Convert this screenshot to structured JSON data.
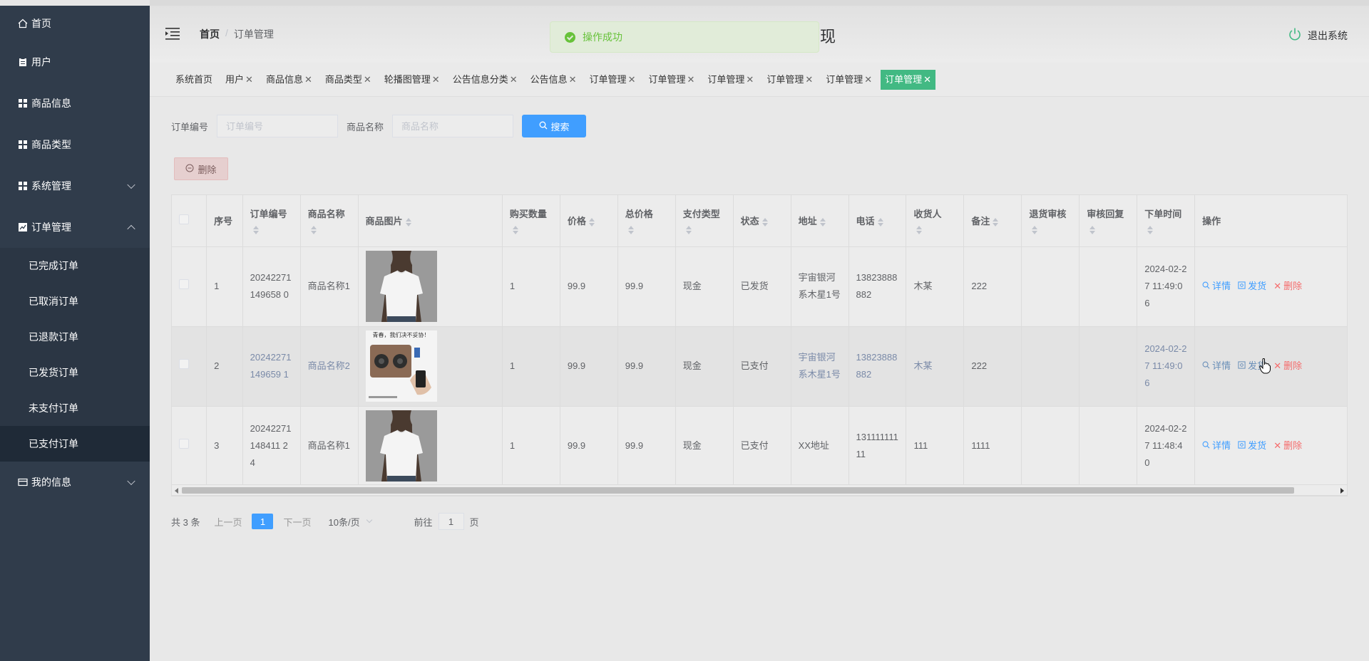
{
  "sidebar": {
    "items": [
      {
        "label": "首页",
        "icon": "home-icon"
      },
      {
        "label": "用户",
        "icon": "clipboard-icon"
      },
      {
        "label": "商品信息",
        "icon": "grid-icon"
      },
      {
        "label": "商品类型",
        "icon": "grid-icon"
      },
      {
        "label": "系统管理",
        "icon": "grid-icon"
      },
      {
        "label": "订单管理",
        "icon": "chart-icon"
      }
    ],
    "sub_items": [
      "已完成订单",
      "已取消订单",
      "已退款订单",
      "已发货订单",
      "未支付订单",
      "已支付订单"
    ],
    "last_item": {
      "label": "我的信息",
      "icon": "card-icon"
    }
  },
  "header": {
    "breadcrumb_home": "首页",
    "breadcrumb_sep": "/",
    "breadcrumb_current": "订单管理",
    "title_partial": "现",
    "logout": "退出系统"
  },
  "toast": {
    "message": "操作成功"
  },
  "tabs": [
    "系统首页",
    "用户",
    "商品信息",
    "商品类型",
    "轮播图管理",
    "公告信息分类",
    "公告信息",
    "订单管理",
    "订单管理",
    "订单管理",
    "订单管理",
    "订单管理",
    "订单管理"
  ],
  "search": {
    "order_no_label": "订单编号",
    "order_no_placeholder": "订单编号",
    "product_name_label": "商品名称",
    "product_name_placeholder": "商品名称",
    "search_button": "搜索"
  },
  "delete_button": "删除",
  "table": {
    "headers": [
      "序号",
      "订单编号",
      "商品名称",
      "商品图片",
      "购买数量",
      "价格",
      "总价格",
      "支付类型",
      "状态",
      "地址",
      "电话",
      "收货人",
      "备注",
      "退货审核",
      "审核回复",
      "下单时间",
      "操作"
    ],
    "rows": [
      {
        "idx": "1",
        "order_no": "20242271149658 0",
        "product": "商品名称1",
        "image": "tshirt",
        "qty": "1",
        "price": "99.9",
        "total": "99.9",
        "pay_type": "现金",
        "status": "已发货",
        "address": "宇宙银河系木星1号",
        "phone": "13823888882",
        "receiver": "木某",
        "remark": "222",
        "return_audit": "",
        "audit_reply": "",
        "time": "2024-02-27 11:49:06"
      },
      {
        "idx": "2",
        "order_no": "20242271149659 1",
        "product": "商品名称2",
        "image": "speaker",
        "qty": "1",
        "price": "99.9",
        "total": "99.9",
        "pay_type": "现金",
        "status": "已支付",
        "address": "宇宙银河系木星1号",
        "phone": "13823888882",
        "receiver": "木某",
        "remark": "222",
        "return_audit": "",
        "audit_reply": "",
        "time": "2024-02-27 11:49:06"
      },
      {
        "idx": "3",
        "order_no": "20242271148411 24",
        "product": "商品名称1",
        "image": "tshirt",
        "qty": "1",
        "price": "99.9",
        "total": "99.9",
        "pay_type": "现金",
        "status": "已支付",
        "address": "XX地址",
        "phone": "13111111111",
        "receiver": "111",
        "remark": "1111",
        "return_audit": "",
        "audit_reply": "",
        "time": "2024-02-27 11:48:40"
      }
    ],
    "ops": {
      "detail": "详情",
      "ship": "发货",
      "delete": "删除"
    },
    "speaker_caption": "青春，我们决不妥协！"
  },
  "pagination": {
    "total": "共 3 条",
    "prev": "上一页",
    "page": "1",
    "next": "下一页",
    "page_size": "10条/页",
    "goto": "前往",
    "goto_value": "1",
    "page_unit": "页"
  }
}
